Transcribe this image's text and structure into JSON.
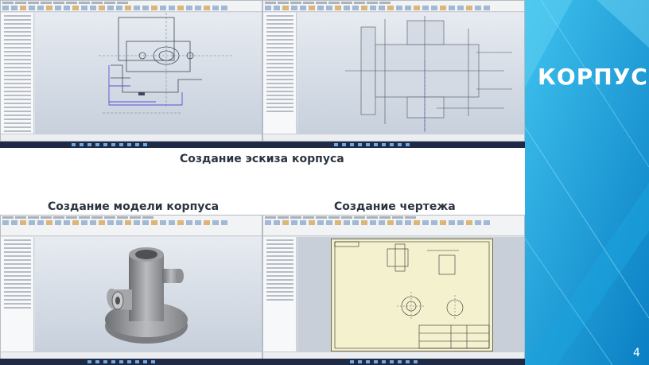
{
  "slide": {
    "title": "КОРПУС",
    "page_number": "4",
    "accent_color": "#2bb4e6",
    "panel_color": "#0e8fd0"
  },
  "captions": {
    "sketch": "Создание эскиза корпуса",
    "model": "Создание модели корпуса",
    "drawing": "Создание чертежа"
  },
  "screenshots": [
    {
      "id": "sketch-left",
      "content": "sketch-view"
    },
    {
      "id": "sketch-right",
      "content": "sketch-view"
    },
    {
      "id": "model",
      "content": "3d-model"
    },
    {
      "id": "drawing",
      "content": "drawing-sheet"
    }
  ]
}
